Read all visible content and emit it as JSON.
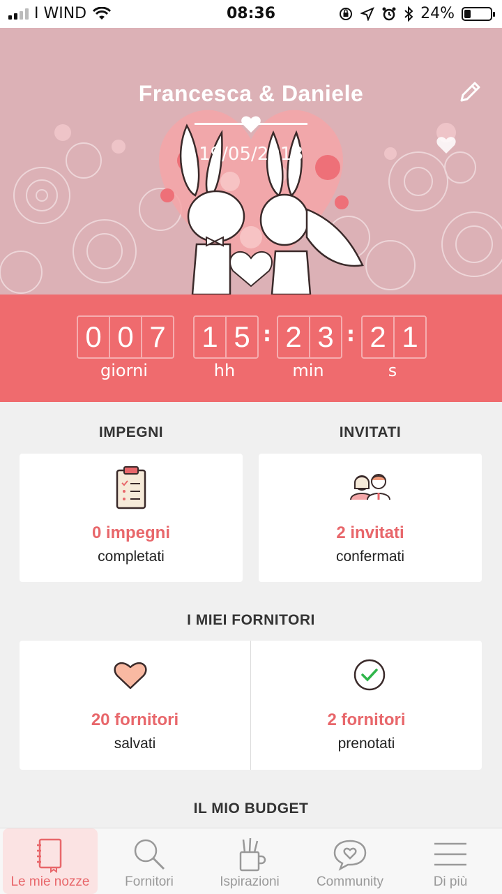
{
  "status_bar": {
    "carrier": "I WIND",
    "time": "08:36",
    "battery_percent_label": "24%",
    "battery_level": 0.24,
    "signal_bars_active": 2
  },
  "hero": {
    "couple_names": "Francesca & Daniele",
    "date": "19/05/2018",
    "background_color": "#dcb1b6"
  },
  "countdown": {
    "days_digits": [
      "0",
      "0",
      "7"
    ],
    "hours_digits": [
      "1",
      "5"
    ],
    "minutes_digits": [
      "2",
      "3"
    ],
    "seconds_digits": [
      "2",
      "1"
    ],
    "days_label": "giorni",
    "hours_label": "hh",
    "minutes_label": "min",
    "seconds_label": "s",
    "background_color": "#ef6b6e"
  },
  "sections": {
    "tasks_title": "IMPEGNI",
    "guests_title": "INVITATI",
    "vendors_title": "I MIEI FORNITORI",
    "budget_title": "IL MIO BUDGET"
  },
  "cards": {
    "tasks": {
      "main": "0 impegni",
      "sub": "completati",
      "icon": "clipboard-icon"
    },
    "guests": {
      "main": "2 invitati",
      "sub": "confermati",
      "icon": "guests-icon"
    },
    "saved_vendors": {
      "main": "20 fornitori",
      "sub": "salvati",
      "icon": "heart-icon"
    },
    "booked_vendors": {
      "main": "2 fornitori",
      "sub": "prenotati",
      "icon": "check-circle-icon"
    }
  },
  "tabbar": {
    "items": [
      {
        "label": "Le mie nozze",
        "icon": "notebook-icon",
        "active": true
      },
      {
        "label": "Fornitori",
        "icon": "search-icon",
        "active": false
      },
      {
        "label": "Ispirazioni",
        "icon": "pencil-cup-icon",
        "active": false
      },
      {
        "label": "Community",
        "icon": "chat-heart-icon",
        "active": false
      },
      {
        "label": "Di più",
        "icon": "menu-icon",
        "active": false
      }
    ]
  },
  "colors": {
    "accent": "#e8676b",
    "inactive": "#999999"
  }
}
